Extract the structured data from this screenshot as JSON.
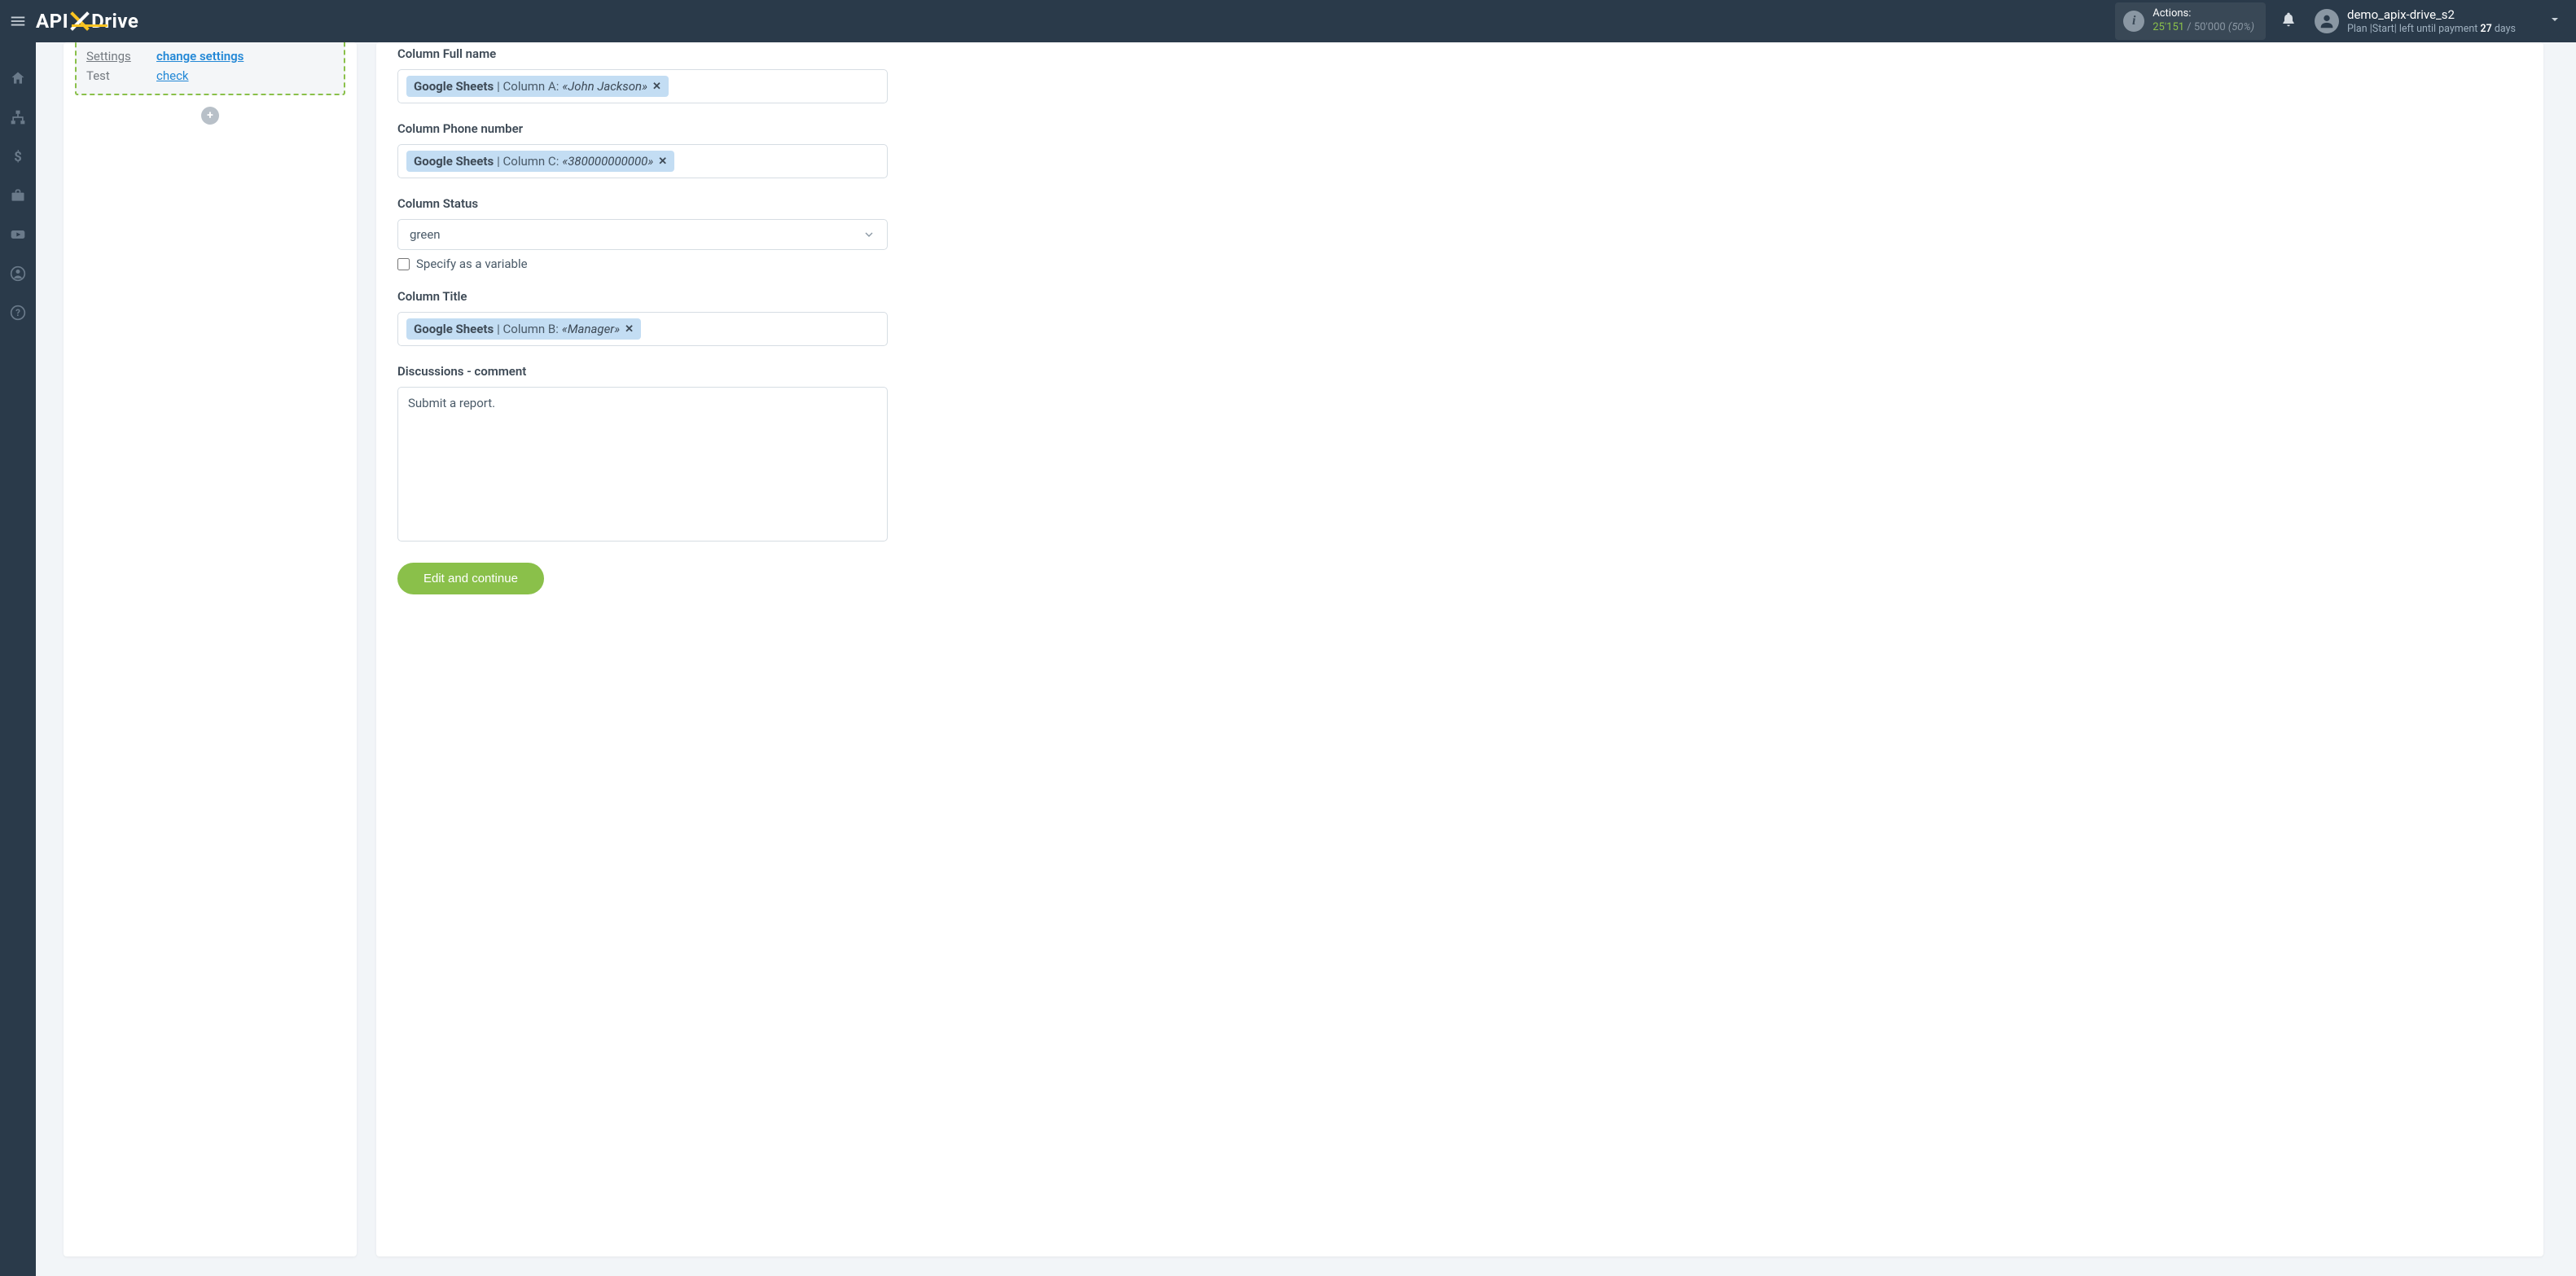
{
  "header": {
    "logo_api": "API",
    "logo_drive": "Drive",
    "actions_label": "Actions:",
    "actions_used": "25'151",
    "actions_total": " / 50'000",
    "actions_pct": " (50%)",
    "username": "demo_apix-drive_s2",
    "plan_prefix": "Plan |Start| left until payment ",
    "plan_days": "27",
    "plan_suffix": " days"
  },
  "left": {
    "row1_label": "Settings",
    "row1_value": "change settings",
    "row2_label": "Test",
    "row2_value": "check",
    "add": "+"
  },
  "form": {
    "f1_label": "Column Full name",
    "f1_tag_bold": "Google Sheets",
    "f1_tag_mid": " | Column A: ",
    "f1_tag_ital": "«John Jackson»",
    "f2_label": "Column Phone number",
    "f2_tag_bold": "Google Sheets",
    "f2_tag_mid": " | Column C: ",
    "f2_tag_ital": "«380000000000»",
    "f3_label": "Column Status",
    "f3_value": "green",
    "f3_checkbox": "Specify as a variable",
    "f4_label": "Column Title",
    "f4_tag_bold": "Google Sheets",
    "f4_tag_mid": " | Column B: ",
    "f4_tag_ital": "«Manager»",
    "f5_label": "Discussions - comment",
    "f5_value": "Submit a report.",
    "button": "Edit and continue"
  }
}
